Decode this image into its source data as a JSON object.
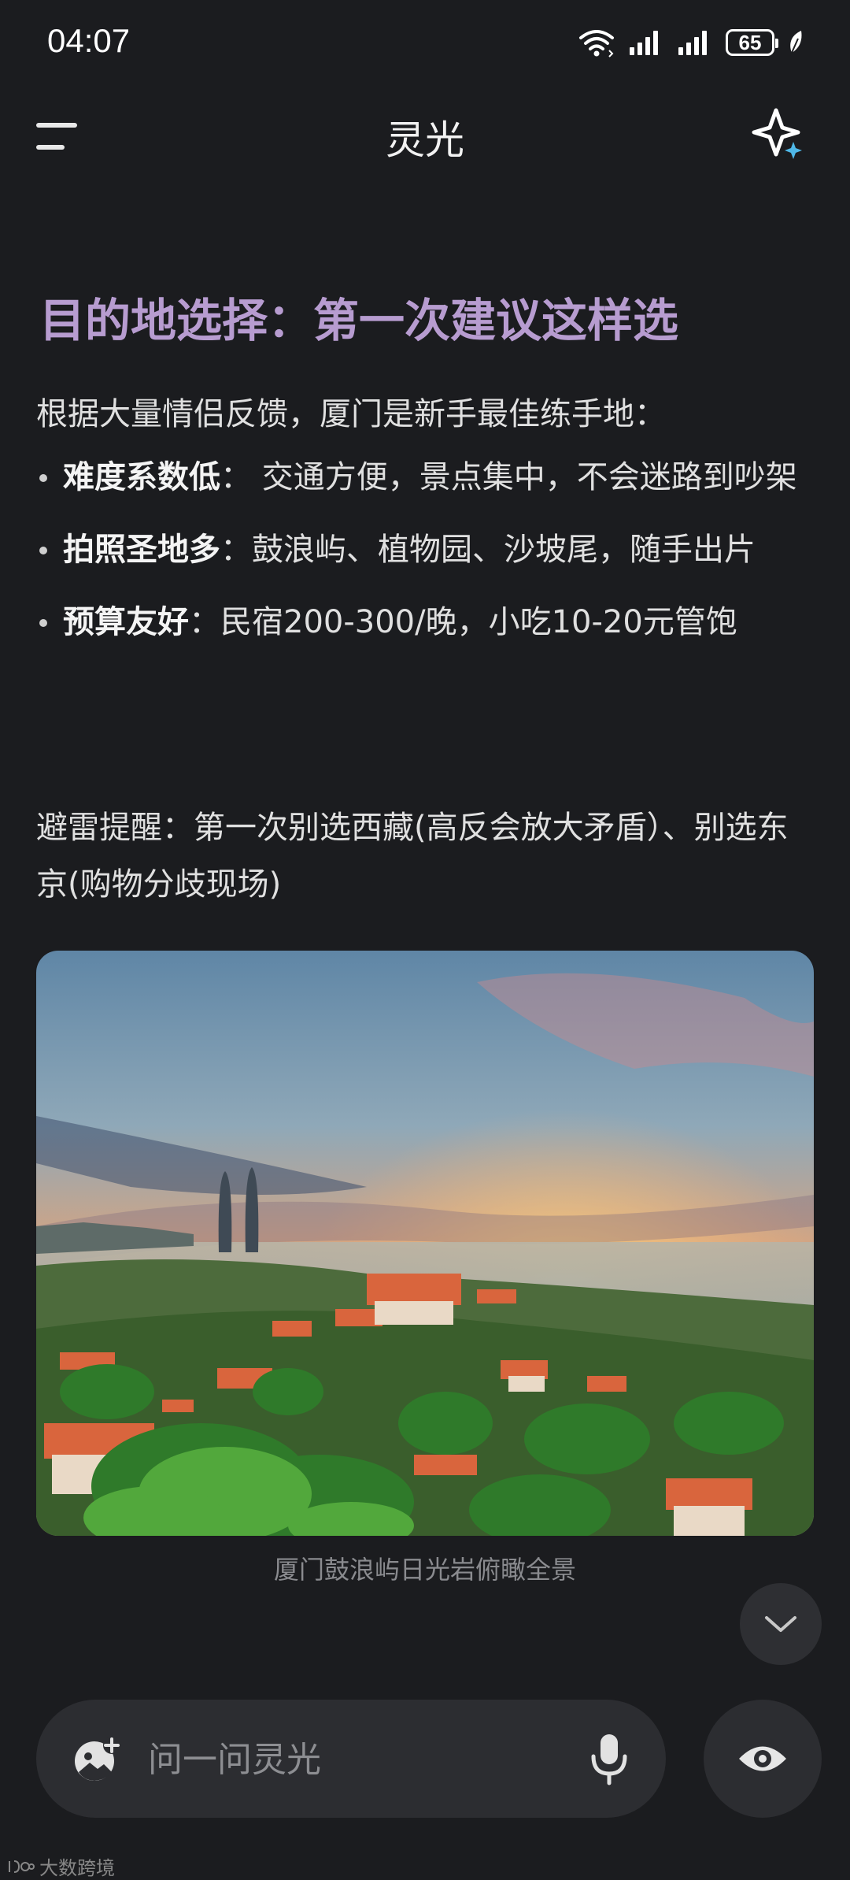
{
  "status_bar": {
    "time": "04:07",
    "battery": "65"
  },
  "header": {
    "title": "灵光"
  },
  "article": {
    "heading": "目的地选择：第一次建议这样选",
    "intro": "根据大量情侣反馈，厦门是新手最佳练手地：",
    "bullets": [
      {
        "term": "难度系数低",
        "sep": "： ",
        "text": "交通方便，景点集中，不会迷路到吵架"
      },
      {
        "term": "拍照圣地多",
        "sep": "：",
        "text": "鼓浪屿、植物园、沙坡尾，随手出片"
      },
      {
        "term": "预算友好",
        "sep": "：",
        "text": "民宿200-300/晚，小吃10-20元管饱"
      }
    ],
    "warning": "避雷提醒：第一次别选西藏(高反会放大矛盾）、别选东京(购物分歧现场)"
  },
  "image": {
    "caption": "厦门鼓浪屿日光岩俯瞰全景"
  },
  "composer": {
    "placeholder": "问一问灵光"
  },
  "watermark": {
    "text": "大数跨境"
  },
  "colors": {
    "background": "#1b1c1f",
    "heading": "#b79cd0",
    "pill": "#2c2d31"
  }
}
